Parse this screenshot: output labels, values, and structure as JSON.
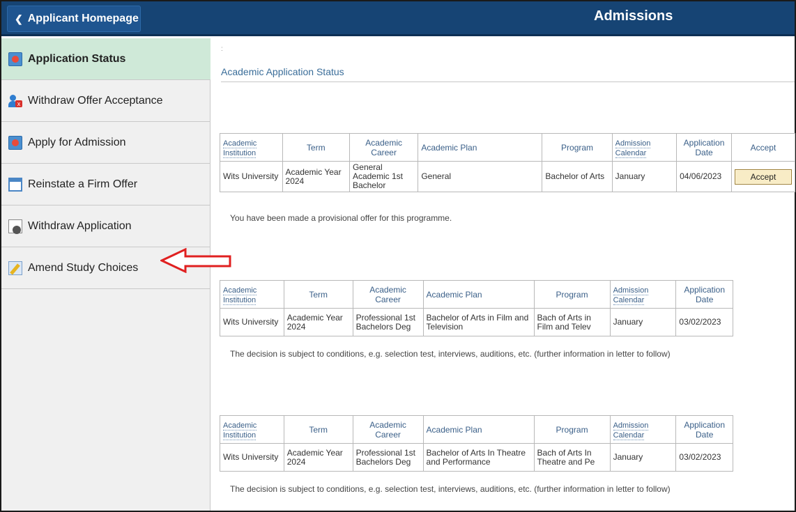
{
  "header": {
    "back_label": "Applicant Homepage",
    "title": "Admissions"
  },
  "sidebar": {
    "items": [
      {
        "label": "Application Status",
        "icon": "application-status-icon",
        "active": true
      },
      {
        "label": "Withdraw Offer Acceptance",
        "icon": "user-remove-icon"
      },
      {
        "label": "Apply for Admission",
        "icon": "application-icon"
      },
      {
        "label": "Reinstate a Firm Offer",
        "icon": "window-icon"
      },
      {
        "label": "Withdraw Application",
        "icon": "document-icon"
      },
      {
        "label": "Amend Study Choices",
        "icon": "edit-icon"
      }
    ]
  },
  "main": {
    "marker": ":",
    "section_title": "Academic Application Status",
    "columns": [
      "Academic Institution",
      "Term",
      "Academic Career",
      "Academic Plan",
      "Program",
      "Admission Calendar",
      "Application Date",
      "Accept"
    ],
    "applications": [
      {
        "institution": "Wits University",
        "term": "Academic Year 2024",
        "career": "General Academic 1st Bachelor",
        "plan": "General",
        "program": "Bachelor of Arts",
        "calendar": "January",
        "date": "04/06/2023",
        "accept_label": "Accept",
        "message": "You have been made a provisional offer for this programme."
      },
      {
        "institution": "Wits University",
        "term": "Academic Year 2024",
        "career": "Professional 1st Bachelors Deg",
        "plan": "Bachelor of Arts in Film and Television",
        "program": "Bach of Arts in Film and Telev",
        "calendar": "January",
        "date": "03/02/2023",
        "message": "The decision is subject to conditions, e.g. selection test, interviews, auditions, etc. (further information in letter to follow)"
      },
      {
        "institution": "Wits University",
        "term": "Academic Year 2024",
        "career": "Professional 1st Bachelors Deg",
        "plan": "Bachelor of Arts In Theatre and Performance",
        "program": "Bach of Arts In Theatre and Pe",
        "calendar": "January",
        "date": "03/02/2023",
        "message": "The decision is subject to conditions, e.g. selection test, interviews, auditions, etc. (further information in letter to follow)"
      }
    ]
  },
  "colors": {
    "header_bg": "#164474",
    "active_nav_bg": "#cfe9d8",
    "link_blue": "#3a6d99",
    "arrow_red": "#e02020"
  }
}
